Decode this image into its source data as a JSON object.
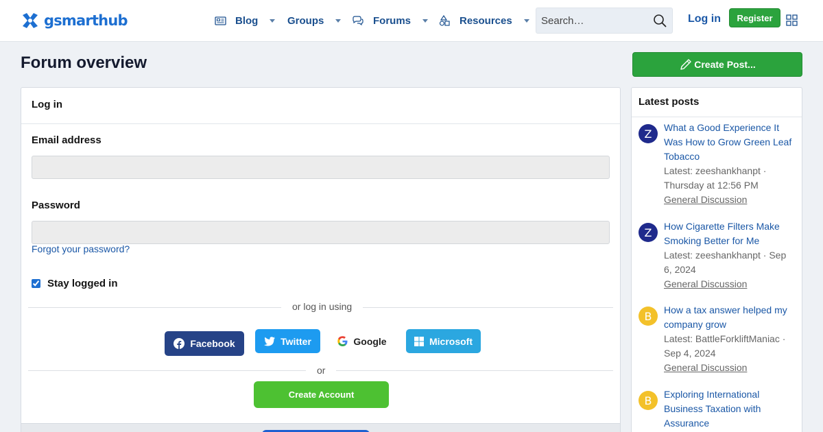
{
  "header": {
    "logo_text": "gsmarthub",
    "nav": [
      {
        "label": "Blog",
        "icon": "newspaper-icon"
      },
      {
        "label": "Groups",
        "icon": ""
      },
      {
        "label": "Forums",
        "icon": "chat-bubbles-icon"
      },
      {
        "label": "Resources",
        "icon": "shapes-icon"
      }
    ],
    "search_placeholder": "Search…",
    "login_label": "Log in",
    "register_label": "Register"
  },
  "page": {
    "title": "Forum overview",
    "create_post_label": "Create Post..."
  },
  "login_panel": {
    "heading": "Log in",
    "email_label": "Email address",
    "password_label": "Password",
    "forgot_label": "Forgot your password?",
    "stay_logged_label": "Stay logged in",
    "stay_logged_checked": true,
    "or_log_in_using": "or log in using",
    "social": [
      {
        "label": "Facebook",
        "color": "#264387"
      },
      {
        "label": "Twitter",
        "color": "#1d9bf0"
      },
      {
        "label": "Google",
        "color": "#ffffff"
      },
      {
        "label": "Microsoft",
        "color": "#2ba7e0"
      }
    ],
    "or_label": "or",
    "create_account_label": "Create Account"
  },
  "sidebar": {
    "heading": "Latest posts",
    "posts": [
      {
        "avatar": "Z",
        "title": "What a Good Experience It Was How to Grow Green Leaf Tobacco",
        "meta": "Latest: zeeshankhanpt · Thursday at 12:56 PM",
        "forum": "General Discussion"
      },
      {
        "avatar": "Z",
        "title": "How Cigarette Filters Make Smoking Better for Me",
        "meta": "Latest: zeeshankhanpt · Sep 6, 2024",
        "forum": "General Discussion"
      },
      {
        "avatar": "B",
        "title": "How a tax answer helped my company grow",
        "meta": "Latest: BattleForkliftManiac · Sep 4, 2024",
        "forum": "General Discussion"
      },
      {
        "avatar": "B",
        "title": "Exploring International Business Taxation with Assurance",
        "meta": "",
        "forum": ""
      }
    ]
  },
  "colors": {
    "brand": "#1d6fd1",
    "accent_green": "#2ba33d",
    "link": "#1a57a6"
  }
}
